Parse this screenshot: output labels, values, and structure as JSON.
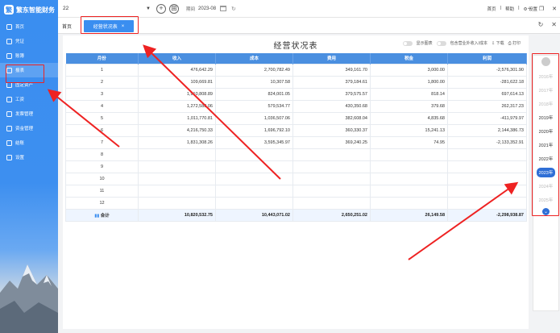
{
  "app": {
    "name": "繁东智能财务",
    "logo_char": "繁"
  },
  "sidebar": {
    "items": [
      {
        "label": "首页"
      },
      {
        "label": "凭证"
      },
      {
        "label": "账簿"
      },
      {
        "label": "报表"
      },
      {
        "label": "固定资产"
      },
      {
        "label": "工资"
      },
      {
        "label": "发票管理"
      },
      {
        "label": "资金管理"
      },
      {
        "label": "结账"
      },
      {
        "label": "设置"
      }
    ]
  },
  "topbar": {
    "account": "22",
    "period_label": "期间",
    "period_value": "2023-08",
    "links": [
      "首页",
      "帮助",
      "设置"
    ],
    "refresh_glyph": "↻"
  },
  "tabs": {
    "home": "首页",
    "active": "经营状况表",
    "close": "×"
  },
  "report": {
    "title": "经营状况表",
    "opt_show_chart": "显示图表",
    "opt_include": "包含营业外收入/成本",
    "download": "下载",
    "print": "打印",
    "columns": [
      "月份",
      "收入",
      "成本",
      "费用",
      "税金",
      "利润"
    ],
    "rows": [
      [
        "1",
        "476,642.29",
        "2,700,782.49",
        "349,161.70",
        "3,000.00",
        "-2,576,301.90"
      ],
      [
        "2",
        "109,669.81",
        "10,307.58",
        "379,184.61",
        "1,800.00",
        "-281,622.18"
      ],
      [
        "3",
        "1,910,808.89",
        "824,001.05",
        "379,575.57",
        "818.14",
        "697,614.13"
      ],
      [
        "4",
        "1,272,583.06",
        "579,534.77",
        "430,350.68",
        "379.68",
        "262,317.23"
      ],
      [
        "5",
        "1,011,770.81",
        "1,036,507.06",
        "382,608.04",
        "4,835.68",
        "-411,979.97"
      ],
      [
        "6",
        "4,216,750.33",
        "1,696,792.10",
        "360,330.37",
        "15,241.13",
        "2,144,386.73"
      ],
      [
        "7",
        "1,831,308.26",
        "3,595,345.97",
        "369,240.25",
        "74.95",
        "-2,133,352.91"
      ],
      [
        "8",
        "",
        "",
        "",
        "",
        ""
      ],
      [
        "9",
        "",
        "",
        "",
        "",
        ""
      ],
      [
        "10",
        "",
        "",
        "",
        "",
        ""
      ],
      [
        "11",
        "",
        "",
        "",
        "",
        ""
      ],
      [
        "12",
        "",
        "",
        "",
        "",
        ""
      ]
    ],
    "total_label": "合计",
    "total": [
      "10,820,532.75",
      "10,443,071.02",
      "2,650,251.02",
      "26,149.58",
      "-2,298,938.87"
    ]
  },
  "years": {
    "items": [
      "2016年",
      "2017年",
      "2018年",
      "2019年",
      "2020年",
      "2021年",
      "2022年",
      "2023年",
      "2024年",
      "2025年"
    ],
    "selected": "2023年",
    "dim": [
      "2016年",
      "2017年",
      "2018年",
      "2024年",
      "2025年"
    ]
  },
  "colors": {
    "accent": "#3a8ef0",
    "header": "#4a8fe0",
    "highlight": "#e22222"
  }
}
